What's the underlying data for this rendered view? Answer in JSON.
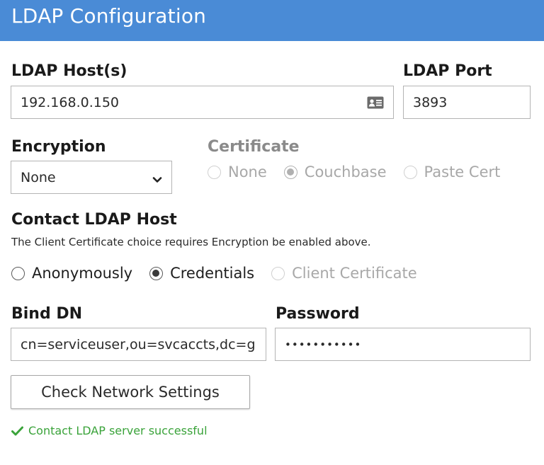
{
  "header": {
    "title": "LDAP Configuration"
  },
  "host": {
    "label": "LDAP Host(s)",
    "value": "192.168.0.150",
    "icon": "contact-card-icon"
  },
  "port": {
    "label": "LDAP Port",
    "value": "3893"
  },
  "encryption": {
    "label": "Encryption",
    "selected": "None"
  },
  "certificate": {
    "label": "Certificate",
    "options": [
      "None",
      "Couchbase",
      "Paste Cert"
    ],
    "selected": "Couchbase",
    "disabled": true
  },
  "contact": {
    "label": "Contact LDAP Host",
    "helper": "The Client Certificate choice requires Encryption be enabled above.",
    "options": [
      "Anonymously",
      "Credentials",
      "Client Certificate"
    ],
    "selected": "Credentials"
  },
  "bind_dn": {
    "label": "Bind DN",
    "value": "cn=serviceuser,ou=svcaccts,dc=gl"
  },
  "password": {
    "label": "Password",
    "value": "•••••••••••"
  },
  "check_button": {
    "label": "Check Network Settings"
  },
  "status": {
    "text": "Contact LDAP server successful",
    "icon": "checkmark-icon",
    "color": "#3aa33a"
  },
  "colors": {
    "header_bg": "#4a8bd6"
  }
}
